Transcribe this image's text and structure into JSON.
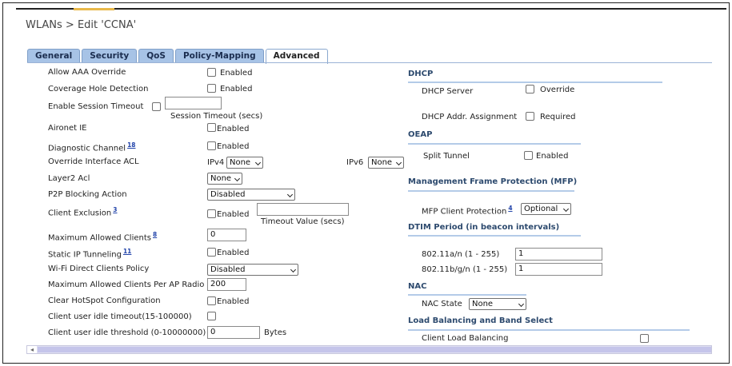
{
  "breadcrumb": "WLANs > Edit  'CCNA'",
  "tabs": [
    "General",
    "Security",
    "QoS",
    "Policy-Mapping",
    "Advanced"
  ],
  "active_tab": "Advanced",
  "left": {
    "allow_aaa_override": {
      "label": "Allow AAA Override",
      "checkbox": "Enabled"
    },
    "coverage_hole": {
      "label": "Coverage Hole Detection",
      "checkbox": "Enabled"
    },
    "session_timeout": {
      "label": "Enable Session Timeout",
      "value": "",
      "caption": "Session Timeout (secs)"
    },
    "aironet_ie": {
      "label": "Aironet IE",
      "checkbox": "Enabled"
    },
    "diagnostic_channel": {
      "label": "Diagnostic Channel",
      "sup": "18",
      "checkbox": "Enabled"
    },
    "override_acl": {
      "label": "Override Interface ACL",
      "ipv4_label": "IPv4",
      "ipv4_value": "None",
      "ipv6_label": "IPv6",
      "ipv6_value": "None"
    },
    "layer2_acl": {
      "label": "Layer2 Acl",
      "value": "None"
    },
    "p2p_blocking": {
      "label": "P2P Blocking Action",
      "value": "Disabled"
    },
    "client_exclusion": {
      "label": "Client Exclusion",
      "sup": "3",
      "checkbox": "Enabled",
      "value": "",
      "caption": "Timeout Value (secs)"
    },
    "max_clients": {
      "label": "Maximum Allowed Clients",
      "sup": "8",
      "value": "0"
    },
    "static_ip_tunneling": {
      "label": "Static IP Tunneling",
      "sup": "11",
      "checkbox": "Enabled"
    },
    "wifi_direct": {
      "label": "Wi-Fi Direct Clients Policy",
      "value": "Disabled"
    },
    "max_per_ap_radio": {
      "label": "Maximum Allowed Clients Per AP Radio",
      "value": "200"
    },
    "clear_hotspot": {
      "label": "Clear HotSpot Configuration",
      "checkbox": "Enabled"
    },
    "idle_timeout": {
      "label": "Client user idle timeout(15-100000)"
    },
    "idle_threshold": {
      "label": "Client user idle threshold (0-10000000)",
      "value": "0",
      "unit": "Bytes"
    }
  },
  "right": {
    "dhcp": {
      "title": "DHCP",
      "server": {
        "label": "DHCP Server",
        "checkbox": "Override"
      },
      "addr_assignment": {
        "label": "DHCP Addr. Assignment",
        "checkbox": "Required"
      }
    },
    "oeap": {
      "title": "OEAP",
      "split_tunnel": {
        "label": "Split Tunnel",
        "checkbox": "Enabled"
      }
    },
    "mfp": {
      "title": "Management Frame Protection (MFP)",
      "client_protection": {
        "label": "MFP Client Protection",
        "sup": "4",
        "value": "Optional"
      }
    },
    "dtim": {
      "title": "DTIM Period (in beacon intervals)",
      "a_n": {
        "label": "802.11a/n (1 - 255)",
        "value": "1"
      },
      "b_g_n": {
        "label": "802.11b/g/n (1 - 255)",
        "value": "1"
      }
    },
    "nac": {
      "title": "NAC",
      "state": {
        "label": "NAC State",
        "value": "None"
      }
    },
    "load_balancing": {
      "title": "Load Balancing and Band Select",
      "client_lb": {
        "label": "Client Load Balancing"
      }
    }
  },
  "icons": {
    "scroll_left": "◂"
  }
}
